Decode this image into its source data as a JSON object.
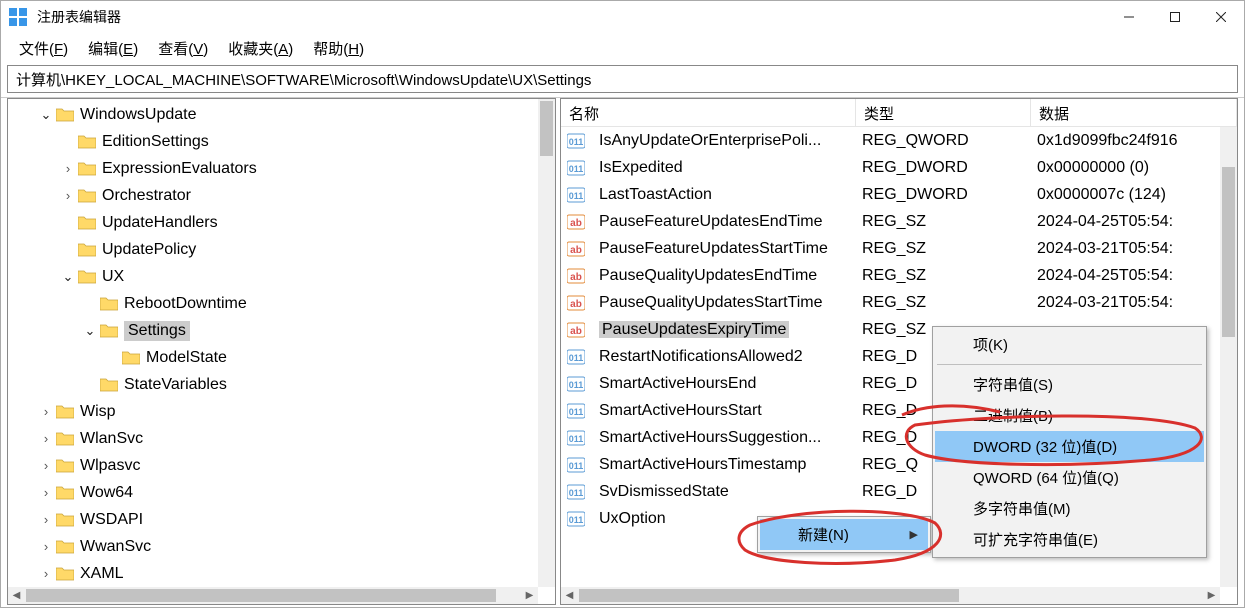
{
  "window": {
    "title": "注册表编辑器"
  },
  "menubar": [
    {
      "label": "文件",
      "mnemonic": "F"
    },
    {
      "label": "编辑",
      "mnemonic": "E"
    },
    {
      "label": "查看",
      "mnemonic": "V"
    },
    {
      "label": "收藏夹",
      "mnemonic": "A"
    },
    {
      "label": "帮助",
      "mnemonic": "H"
    }
  ],
  "address": "计算机\\HKEY_LOCAL_MACHINE\\SOFTWARE\\Microsoft\\WindowsUpdate\\UX\\Settings",
  "tree": [
    {
      "indent": 1,
      "twisty": "open",
      "label": "WindowsUpdate"
    },
    {
      "indent": 2,
      "twisty": "none",
      "label": "EditionSettings"
    },
    {
      "indent": 2,
      "twisty": "closed",
      "label": "ExpressionEvaluators"
    },
    {
      "indent": 2,
      "twisty": "closed",
      "label": "Orchestrator"
    },
    {
      "indent": 2,
      "twisty": "none",
      "label": "UpdateHandlers"
    },
    {
      "indent": 2,
      "twisty": "none",
      "label": "UpdatePolicy"
    },
    {
      "indent": 2,
      "twisty": "open",
      "label": "UX"
    },
    {
      "indent": 3,
      "twisty": "none",
      "label": "RebootDowntime"
    },
    {
      "indent": 3,
      "twisty": "open",
      "label": "Settings",
      "selected": true
    },
    {
      "indent": 4,
      "twisty": "none",
      "label": "ModelState"
    },
    {
      "indent": 3,
      "twisty": "none",
      "label": "StateVariables"
    },
    {
      "indent": 1,
      "twisty": "closed",
      "label": "Wisp"
    },
    {
      "indent": 1,
      "twisty": "closed",
      "label": "WlanSvc"
    },
    {
      "indent": 1,
      "twisty": "closed",
      "label": "Wlpasvc"
    },
    {
      "indent": 1,
      "twisty": "closed",
      "label": "Wow64"
    },
    {
      "indent": 1,
      "twisty": "closed",
      "label": "WSDAPI"
    },
    {
      "indent": 1,
      "twisty": "closed",
      "label": "WwanSvc"
    },
    {
      "indent": 1,
      "twisty": "closed",
      "label": "XAML"
    }
  ],
  "list": {
    "headers": {
      "name": "名称",
      "type": "类型",
      "data": "数据"
    },
    "rows": [
      {
        "icon": "bin",
        "name": "IsAnyUpdateOrEnterprisePoli...",
        "type": "REG_QWORD",
        "data": "0x1d9099fbc24f916"
      },
      {
        "icon": "bin",
        "name": "IsExpedited",
        "type": "REG_DWORD",
        "data": "0x00000000 (0)"
      },
      {
        "icon": "bin",
        "name": "LastToastAction",
        "type": "REG_DWORD",
        "data": "0x0000007c (124)"
      },
      {
        "icon": "str",
        "name": "PauseFeatureUpdatesEndTime",
        "type": "REG_SZ",
        "data": "2024-04-25T05:54:"
      },
      {
        "icon": "str",
        "name": "PauseFeatureUpdatesStartTime",
        "type": "REG_SZ",
        "data": "2024-03-21T05:54:"
      },
      {
        "icon": "str",
        "name": "PauseQualityUpdatesEndTime",
        "type": "REG_SZ",
        "data": "2024-04-25T05:54:"
      },
      {
        "icon": "str",
        "name": "PauseQualityUpdatesStartTime",
        "type": "REG_SZ",
        "data": "2024-03-21T05:54:"
      },
      {
        "icon": "str",
        "name": "PauseUpdatesExpiryTime",
        "type": "REG_SZ",
        "data": "",
        "selected": true
      },
      {
        "icon": "bin",
        "name": "RestartNotificationsAllowed2",
        "type": "REG_D",
        "data": ""
      },
      {
        "icon": "bin",
        "name": "SmartActiveHoursEnd",
        "type": "REG_D",
        "data": ""
      },
      {
        "icon": "bin",
        "name": "SmartActiveHoursStart",
        "type": "REG_D",
        "data": ""
      },
      {
        "icon": "bin",
        "name": "SmartActiveHoursSuggestion...",
        "type": "REG_D",
        "data": ""
      },
      {
        "icon": "bin",
        "name": "SmartActiveHoursTimestamp",
        "type": "REG_Q",
        "data": ""
      },
      {
        "icon": "bin",
        "name": "SvDismissedState",
        "type": "REG_D",
        "data": ""
      },
      {
        "icon": "bin",
        "name": "UxOption",
        "type": "",
        "data": ""
      }
    ]
  },
  "context_menu": {
    "new": "新建(N)"
  },
  "submenu": [
    {
      "label": "项(K)"
    },
    {
      "label": "字符串值(S)"
    },
    {
      "label": "二进制值(B)"
    },
    {
      "label": "DWORD (32 位)值(D)",
      "highlight": true
    },
    {
      "label": "QWORD (64 位)值(Q)"
    },
    {
      "label": "多字符串值(M)"
    },
    {
      "label": "可扩充字符串值(E)"
    }
  ]
}
